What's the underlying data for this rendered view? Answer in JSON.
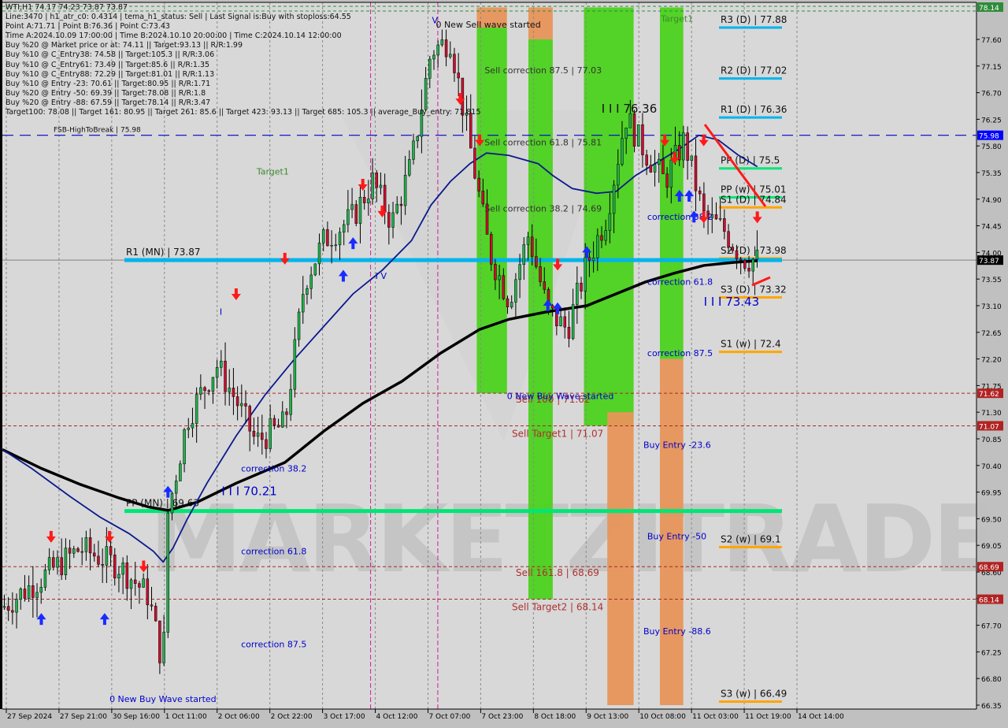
{
  "window": {
    "symbol_line": "WTI,H1  74.17 74.23 73.87 73.87"
  },
  "info_panel": [
    "Line:3470 | h1_atr_c0: 0.4314 | tema_h1_status: Sell | Last Signal is:Buy with stoploss:64.55",
    "Point A:71.71 | Point B:76.36 | Point C:73.43",
    "Time A:2024.10.09 17:00:00 | Time B:2024.10.10 20:00:00 | Time C:2024.10.14 12:00:00",
    "Buy %20 @ Market price or at: 74.11 || Target:93.13 || R/R:1.99",
    "Buy %10 @ C_Entry38: 74.58 || Target:105.3 || R/R:3.06",
    "Buy %10 @ C_Entry61: 73.49 || Target:85.6 || R/R:1.35",
    "Buy %10 @ C_Entry88: 72.29 || Target:81.01 || R/R:1.13",
    "Buy %10 @ Entry -23: 70.61 || Target:80.95 || R/R:1.71",
    "Buy %20 @ Entry -50: 69.39 || Target:78.08 || R/R:1.8",
    "Buy %20 @ Entry -88: 67.59 || Target:78.14 || R/R:3.47",
    "Target100: 78.08 || Target 161: 80.95 || Target 261: 85.6 || Target 423: 93.13 || Target 685: 105.3 || average_Buy_entry: 71.815"
  ],
  "colors": {
    "background": "#d8d8d8",
    "axis_bg": "#c0c0c0",
    "bull_candle": "#22b14c",
    "bear_candle": "#c8102e",
    "ma_fast": "#0a1a8c",
    "ma_slow": "#000000",
    "pivot_resistance": "#00b4ec",
    "pivot_pp": "#00e676",
    "pivot_support": "#ffa500",
    "sell_zone_green": "#4cd21e",
    "buy_zone_orange": "#e8955a",
    "sell_level_line": "#a52a2a",
    "fsb_line": "#0000cd",
    "annot_blue": "#0000cc",
    "price_current_bg": "#000000",
    "price_fsb_bg": "#0000ff",
    "price_sell_bg": "#b22222",
    "price_top_bg": "#2e8b3a"
  },
  "chart_data": {
    "type": "candlestick",
    "title": "WTI,H1",
    "ohlc_header": {
      "open": 74.17,
      "high": 74.23,
      "low": 73.87,
      "close": 73.87
    },
    "ylim": [
      66.35,
      78.14
    ],
    "y_ticks": [
      "77.60",
      "77.15",
      "76.70",
      "76.25",
      "75.80",
      "75.35",
      "74.90",
      "74.45",
      "74.00",
      "73.55",
      "73.10",
      "72.65",
      "72.20",
      "71.75",
      "71.30",
      "70.85",
      "70.40",
      "69.95",
      "69.50",
      "69.05",
      "68.60",
      "68.15",
      "67.70",
      "67.25",
      "66.80",
      "66.35"
    ],
    "x_ticks": [
      "27 Sep 2024",
      "27 Sep 21:00",
      "30 Sep 16:00",
      "1 Oct 11:00",
      "2 Oct 06:00",
      "2 Oct 22:00",
      "3 Oct 17:00",
      "4 Oct 12:00",
      "7 Oct 07:00",
      "7 Oct 23:00",
      "8 Oct 18:00",
      "9 Oct 13:00",
      "10 Oct 08:00",
      "11 Oct 03:00",
      "11 Oct 19:00",
      "14 Oct 14:00"
    ],
    "price_labels": [
      {
        "value": "78.14",
        "kind": "top"
      },
      {
        "value": "75.98",
        "kind": "fsb"
      },
      {
        "value": "73.87",
        "kind": "current"
      },
      {
        "value": "71.62",
        "kind": "sell"
      },
      {
        "value": "71.07",
        "kind": "sell"
      },
      {
        "value": "68.69",
        "kind": "sell"
      },
      {
        "value": "68.14",
        "kind": "sell"
      }
    ],
    "pivot_levels": [
      {
        "label": "R3 (D) | 77.88",
        "price": 77.88,
        "kind": "resistance",
        "span": "daily"
      },
      {
        "label": "R2 (D) | 77.02",
        "price": 77.02,
        "kind": "resistance",
        "span": "daily"
      },
      {
        "label": "R1 (D) | 76.36",
        "price": 76.36,
        "kind": "resistance",
        "span": "daily"
      },
      {
        "label": "PP (D) | 75.5",
        "price": 75.5,
        "kind": "pp",
        "span": "daily"
      },
      {
        "label": "PP (w) | 75.01",
        "price": 75.01,
        "kind": "pp",
        "span": "daily"
      },
      {
        "label": "S1 (D) | 74.84",
        "price": 74.84,
        "kind": "support",
        "span": "daily"
      },
      {
        "label": "S2 (D) | 73.98",
        "price": 73.98,
        "kind": "support",
        "span": "daily"
      },
      {
        "label": "S3 (D) | 73.32",
        "price": 73.32,
        "kind": "support",
        "span": "daily"
      },
      {
        "label": "S1 (w) | 72.4",
        "price": 72.4,
        "kind": "support",
        "span": "daily"
      },
      {
        "label": "S2 (w) | 69.1",
        "price": 69.1,
        "kind": "support",
        "span": "daily"
      },
      {
        "label": "S3 (w) | 66.49",
        "price": 66.49,
        "kind": "support",
        "span": "daily"
      },
      {
        "label": "R1 (MN) | 73.87",
        "price": 73.87,
        "kind": "resistance",
        "span": "monthly"
      },
      {
        "label": "PP (MN) | 69.63",
        "price": 69.63,
        "kind": "pp",
        "span": "monthly"
      }
    ],
    "sell_levels": [
      {
        "label": "Sell 100 | 71.62",
        "price": 71.62
      },
      {
        "label": "Sell Target1 | 71.07",
        "price": 71.07
      },
      {
        "label": "Sell 161.8 | 68.69",
        "price": 68.69
      },
      {
        "label": "Sell Target2 | 68.14",
        "price": 68.14
      }
    ],
    "fsb_line": {
      "label": "FSB-HighToBreak | 75.98",
      "price": 75.98
    },
    "annotations": [
      {
        "text": "0 New Sell wave started",
        "price": 77.8,
        "x_frac": 0.445,
        "color": "dark"
      },
      {
        "text": "Sell correction 87.5 | 77.03",
        "price": 77.03,
        "x_frac": 0.495,
        "color": "darkgrey"
      },
      {
        "text": "Sell correction 61.8 | 75.81",
        "price": 75.81,
        "x_frac": 0.495,
        "color": "darkgrey"
      },
      {
        "text": "Sell correction 38.2 | 74.69",
        "price": 74.69,
        "x_frac": 0.495,
        "color": "darkgrey"
      },
      {
        "text": "I I I 76.36",
        "price": 76.36,
        "x_frac": 0.615,
        "color": "dark",
        "big": true
      },
      {
        "text": "Target1",
        "price": 77.9,
        "x_frac": 0.676,
        "color": "green"
      },
      {
        "text": "Target1",
        "price": 75.32,
        "x_frac": 0.261,
        "color": "green"
      },
      {
        "text": "correction 38.2",
        "price": 74.55,
        "x_frac": 0.662,
        "color": "blue"
      },
      {
        "text": "correction 61.8",
        "price": 73.45,
        "x_frac": 0.662,
        "color": "blue"
      },
      {
        "text": "correction 87.5",
        "price": 72.25,
        "x_frac": 0.662,
        "color": "blue"
      },
      {
        "text": "I I I 73.43",
        "price": 73.1,
        "x_frac": 0.72,
        "color": "blue",
        "big": true
      },
      {
        "text": "0 New Buy Wave started",
        "price": 71.52,
        "x_frac": 0.518,
        "color": "blue"
      },
      {
        "text": "Buy Entry -23.6",
        "price": 70.7,
        "x_frac": 0.658,
        "color": "blue"
      },
      {
        "text": "Buy Entry -50",
        "price": 69.15,
        "x_frac": 0.662,
        "color": "blue"
      },
      {
        "text": "Buy Entry -88.6",
        "price": 67.55,
        "x_frac": 0.658,
        "color": "blue"
      },
      {
        "text": "correction 38.2",
        "price": 70.3,
        "x_frac": 0.245,
        "color": "blue"
      },
      {
        "text": "correction 61.8",
        "price": 68.9,
        "x_frac": 0.245,
        "color": "blue"
      },
      {
        "text": "correction 87.5",
        "price": 67.33,
        "x_frac": 0.245,
        "color": "blue"
      },
      {
        "text": "I I I 70.21",
        "price": 69.9,
        "x_frac": 0.225,
        "color": "blue",
        "big": true
      },
      {
        "text": "0 New Buy Wave started",
        "price": 66.4,
        "x_frac": 0.11,
        "color": "blue"
      },
      {
        "text": "I V",
        "price": 73.55,
        "x_frac": 0.383,
        "color": "blue"
      },
      {
        "text": "V",
        "price": 77.87,
        "x_frac": 0.441,
        "color": "blue"
      },
      {
        "text": "I",
        "price": 72.95,
        "x_frac": 0.223,
        "color": "blue"
      }
    ],
    "zones": [
      {
        "kind": "green",
        "x_frac": [
          0.487,
          0.518
        ],
        "price": [
          71.62,
          77.8
        ]
      },
      {
        "kind": "orange",
        "x_frac": [
          0.487,
          0.518
        ],
        "price": [
          77.8,
          78.14
        ]
      },
      {
        "kind": "green",
        "x_frac": [
          0.54,
          0.565
        ],
        "price": [
          68.14,
          77.6
        ]
      },
      {
        "kind": "orange",
        "x_frac": [
          0.54,
          0.565
        ],
        "price": [
          77.6,
          78.14
        ]
      },
      {
        "kind": "green",
        "x_frac": [
          0.597,
          0.648
        ],
        "price": [
          71.07,
          78.14
        ]
      },
      {
        "kind": "orange",
        "x_frac": [
          0.621,
          0.648
        ],
        "price": [
          66.35,
          71.3
        ]
      },
      {
        "kind": "green",
        "x_frac": [
          0.675,
          0.699
        ],
        "price": [
          72.2,
          78.14
        ]
      },
      {
        "kind": "orange",
        "x_frac": [
          0.675,
          0.699
        ],
        "price": [
          66.35,
          72.2
        ]
      }
    ],
    "ma_fast": [
      [
        0.0,
        70.67
      ],
      [
        0.03,
        70.35
      ],
      [
        0.07,
        69.87
      ],
      [
        0.1,
        69.53
      ],
      [
        0.13,
        69.25
      ],
      [
        0.155,
        68.95
      ],
      [
        0.165,
        68.77
      ],
      [
        0.175,
        69.0
      ],
      [
        0.19,
        69.5
      ],
      [
        0.21,
        70.1
      ],
      [
        0.24,
        70.9
      ],
      [
        0.27,
        71.6
      ],
      [
        0.3,
        72.2
      ],
      [
        0.33,
        72.75
      ],
      [
        0.36,
        73.3
      ],
      [
        0.39,
        73.7
      ],
      [
        0.42,
        74.2
      ],
      [
        0.44,
        74.8
      ],
      [
        0.46,
        75.2
      ],
      [
        0.48,
        75.5
      ],
      [
        0.497,
        75.68
      ],
      [
        0.52,
        75.64
      ],
      [
        0.55,
        75.5
      ],
      [
        0.565,
        75.3
      ],
      [
        0.585,
        75.08
      ],
      [
        0.61,
        75.0
      ],
      [
        0.63,
        75.03
      ],
      [
        0.65,
        75.3
      ],
      [
        0.675,
        75.55
      ],
      [
        0.695,
        75.75
      ],
      [
        0.715,
        75.98
      ],
      [
        0.735,
        75.9
      ],
      [
        0.755,
        75.65
      ],
      [
        0.775,
        75.45
      ]
    ],
    "ma_slow": [
      [
        0.0,
        70.67
      ],
      [
        0.04,
        70.35
      ],
      [
        0.08,
        70.08
      ],
      [
        0.12,
        69.85
      ],
      [
        0.15,
        69.7
      ],
      [
        0.17,
        69.64
      ],
      [
        0.2,
        69.78
      ],
      [
        0.24,
        70.1
      ],
      [
        0.29,
        70.45
      ],
      [
        0.33,
        70.98
      ],
      [
        0.37,
        71.45
      ],
      [
        0.41,
        71.82
      ],
      [
        0.45,
        72.3
      ],
      [
        0.49,
        72.7
      ],
      [
        0.52,
        72.87
      ],
      [
        0.56,
        73.0
      ],
      [
        0.6,
        73.1
      ],
      [
        0.63,
        73.3
      ],
      [
        0.66,
        73.5
      ],
      [
        0.69,
        73.65
      ],
      [
        0.72,
        73.78
      ],
      [
        0.75,
        73.83
      ],
      [
        0.775,
        73.86
      ]
    ],
    "candles_summary": {
      "last_close": 73.87,
      "session_high": 77.7,
      "session_low": 66.7
    }
  }
}
